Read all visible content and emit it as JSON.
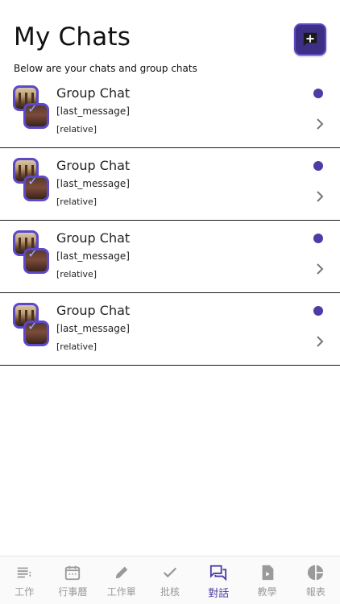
{
  "header": {
    "title": "My Chats",
    "subtitle": "Below are your chats and group chats",
    "new_chat_icon": "add-comment-icon"
  },
  "chats": [
    {
      "name": "Group Chat",
      "last_message": "[last_message]",
      "time": "[relative]",
      "unread": true
    },
    {
      "name": "Group Chat",
      "last_message": "[last_message]",
      "time": "[relative]",
      "unread": true
    },
    {
      "name": "Group Chat",
      "last_message": "[last_message]",
      "time": "[relative]",
      "unread": true
    },
    {
      "name": "Group Chat",
      "last_message": "[last_message]",
      "time": "[relative]",
      "unread": true
    }
  ],
  "tabs": [
    {
      "label": "工作",
      "icon": "list-icon",
      "active": false
    },
    {
      "label": "行事曆",
      "icon": "calendar-icon",
      "active": false
    },
    {
      "label": "工作單",
      "icon": "pencil-icon",
      "active": false
    },
    {
      "label": "批核",
      "icon": "check-icon",
      "active": false
    },
    {
      "label": "對話",
      "icon": "chat-icon",
      "active": true
    },
    {
      "label": "教學",
      "icon": "video-file-icon",
      "active": false
    },
    {
      "label": "報表",
      "icon": "pie-chart-icon",
      "active": false
    }
  ],
  "colors": {
    "accent": "#4b3ca6",
    "accent_border": "#5b49c9",
    "inactive": "#9a9a9a",
    "divider": "#1a1a1a"
  }
}
